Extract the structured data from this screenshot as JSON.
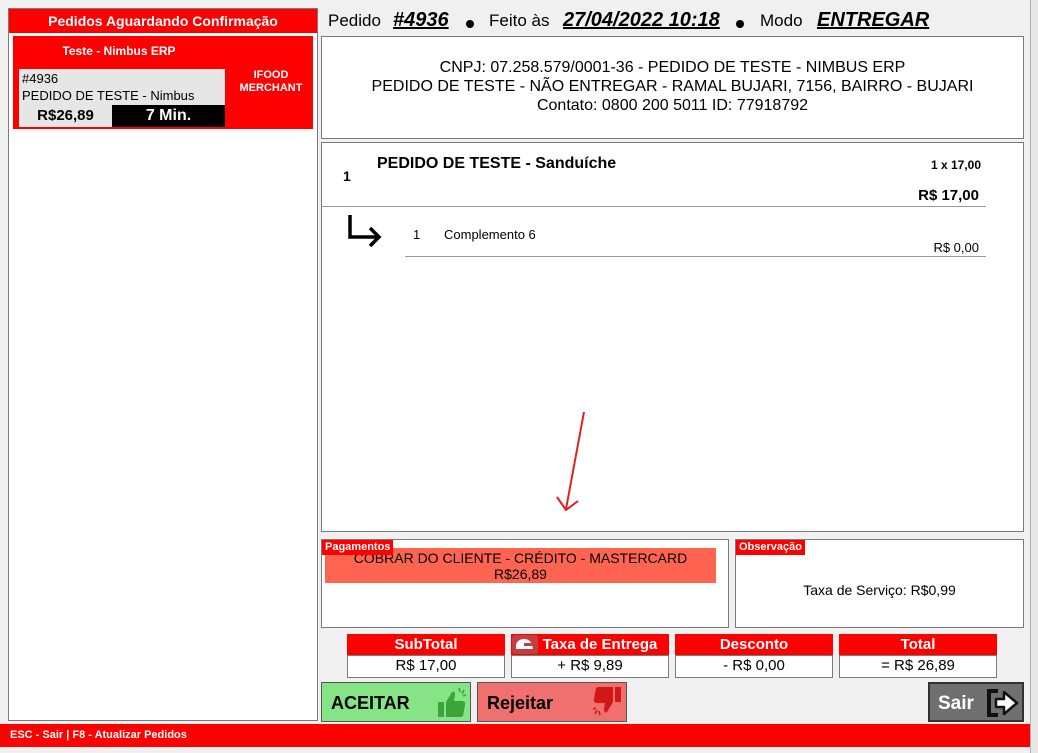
{
  "left": {
    "title": "Pedidos Aguardando Confirmação",
    "card": {
      "company": "Teste - Nimbus ERP",
      "number": "#4936",
      "name": "PEDIDO DE TESTE - Nimbus",
      "source_line1": "IFOOD",
      "source_line2": "MERCHANT",
      "price": "R$26,89",
      "time": "7 Min."
    }
  },
  "header": {
    "pedido_label": "Pedido",
    "pedido_value": "#4936",
    "feito_label": "Feito às",
    "feito_value": "27/04/2022 10:18",
    "modo_label": "Modo",
    "modo_value": "ENTREGAR"
  },
  "customer": {
    "line1": "CNPJ: 07.258.579/0001-36 - PEDIDO DE TESTE - NIMBUS ERP",
    "line2": "PEDIDO DE TESTE - NÃO ENTREGAR - RAMAL BUJARI, 7156, BAIRRO - BUJARI",
    "line3": "Contato: 0800 200 5011 ID: 77918792"
  },
  "items": [
    {
      "qty": "1",
      "name": "PEDIDO DE TESTE - Sanduíche",
      "unit": "1 x 17,00",
      "price": "R$ 17,00",
      "complements": [
        {
          "qty": "1",
          "name": "Complemento 6",
          "price": "R$ 0,00"
        }
      ]
    }
  ],
  "payment": {
    "label": "Pagamentos",
    "method": "COBRAR DO CLIENTE - CRÉDITO - MASTERCARD",
    "amount": "R$26,89"
  },
  "observation": {
    "label": "Observação",
    "text": "Taxa de Serviço: R$0,99"
  },
  "totals": [
    {
      "label": "SubTotal",
      "value": "R$ 17,00"
    },
    {
      "label": "Taxa de Entrega",
      "value": "+ R$ 9,89"
    },
    {
      "label": "Desconto",
      "value": "- R$ 0,00"
    },
    {
      "label": "Total",
      "value": "= R$ 26,89"
    }
  ],
  "buttons": {
    "accept": "ACEITAR",
    "reject": "Rejeitar",
    "exit": "Sair"
  },
  "status_bar": "ESC - Sair  | F8 - Atualizar Pedidos",
  "colors": {
    "accent_red": "#ff0000",
    "payment_box": "#ff6450",
    "accept_green": "#86e486",
    "reject_red": "#f07070",
    "exit_gray": "#707070"
  }
}
